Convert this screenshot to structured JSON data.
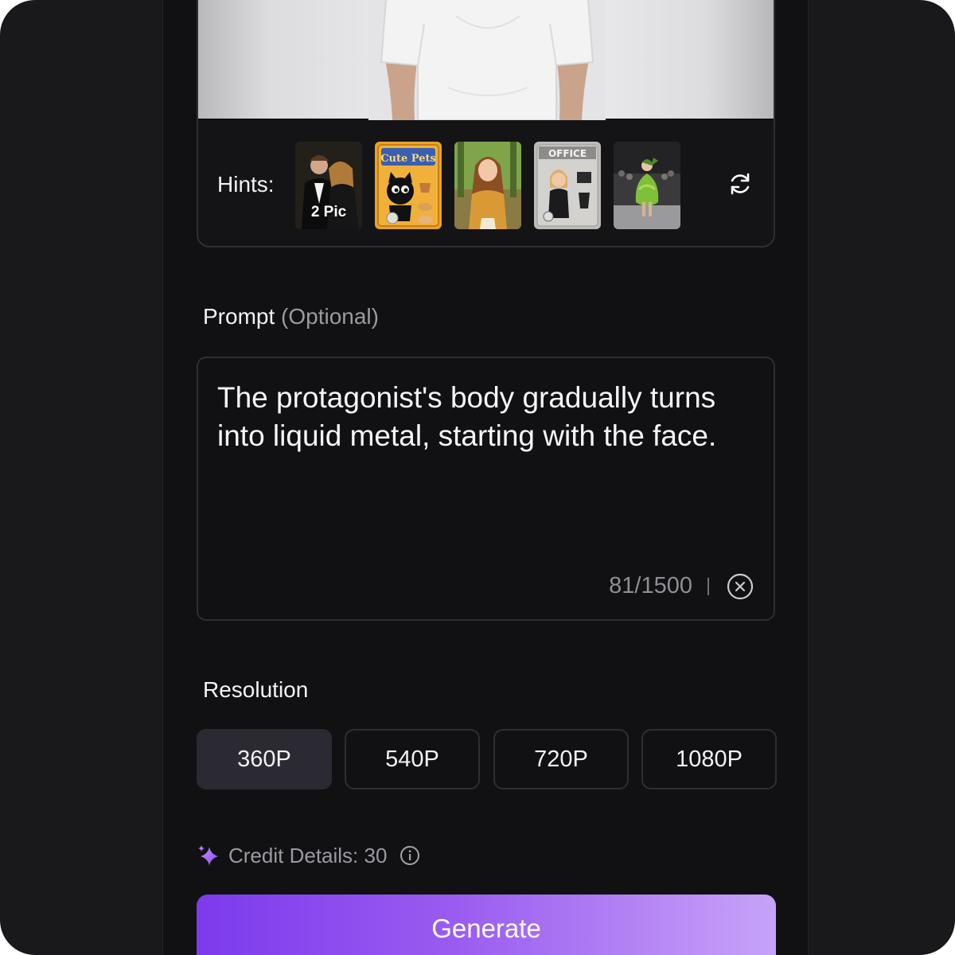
{
  "upload": {
    "preview_image": "man-in-white-tshirt-photo"
  },
  "hints": {
    "label": "Hints:",
    "items": [
      {
        "icon": "couple-portrait-thumbnail",
        "caption": "2 Pic"
      },
      {
        "icon": "cute-pets-toy-box-thumbnail",
        "title": "Cute Pets"
      },
      {
        "icon": "anime-girl-sweater-thumbnail"
      },
      {
        "icon": "office-figure-box-thumbnail",
        "title": "OFFICE"
      },
      {
        "icon": "runway-green-dress-thumbnail"
      }
    ],
    "refresh_icon": "refresh-icon"
  },
  "prompt": {
    "title": "Prompt",
    "optional": "(Optional)",
    "text": "The protagonist's body gradually turns into liquid metal, starting with the face.",
    "counter": "81/1500",
    "clear_icon": "clear-circle-x-icon"
  },
  "resolution": {
    "title": "Resolution",
    "options": [
      "360P",
      "540P",
      "720P",
      "1080P"
    ],
    "selected": "360P"
  },
  "credit": {
    "icon": "sparkle-icon",
    "label": "Credit Details: 30",
    "info_icon": "info-icon"
  },
  "generate": {
    "label": "Generate"
  },
  "colors": {
    "background": "#111113",
    "accent_start": "#7c3aed",
    "accent_end": "#c7a3f8",
    "selected_bg": "#2b2a33",
    "border": "#2e2e33"
  }
}
